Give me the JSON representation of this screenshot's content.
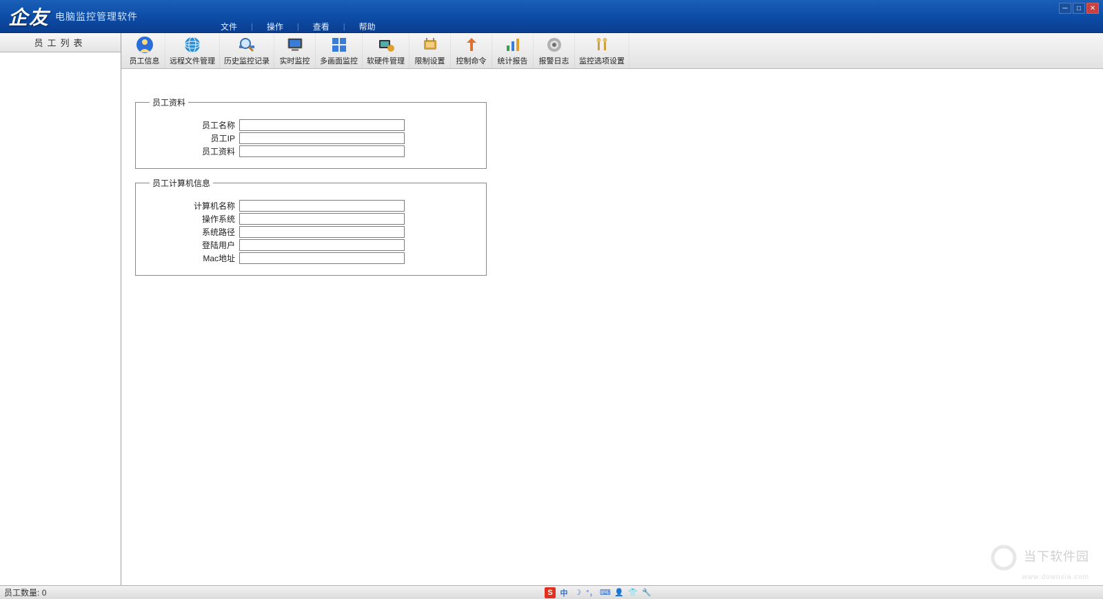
{
  "app": {
    "logo": "企友",
    "subtitle": "电脑监控管理软件"
  },
  "menu": {
    "items": [
      "文件",
      "操作",
      "查看",
      "帮助"
    ]
  },
  "sidebar": {
    "title": "员工列表"
  },
  "toolbar": {
    "items": [
      {
        "label": "员工信息",
        "icon": "person"
      },
      {
        "label": "远程文件管理",
        "icon": "globe"
      },
      {
        "label": "历史监控记录",
        "icon": "magnifier"
      },
      {
        "label": "实时监控",
        "icon": "monitor"
      },
      {
        "label": "多画面监控",
        "icon": "grid"
      },
      {
        "label": "软硬件管理",
        "icon": "hwsw"
      },
      {
        "label": "限制设置",
        "icon": "limit"
      },
      {
        "label": "控制命令",
        "icon": "control"
      },
      {
        "label": "统计报告",
        "icon": "chart"
      },
      {
        "label": "报警日志",
        "icon": "alarm"
      },
      {
        "label": "监控选项设置",
        "icon": "settings"
      }
    ]
  },
  "form": {
    "group1_title": "员工资料",
    "group1": [
      {
        "label": "员工名称",
        "value": ""
      },
      {
        "label": "员工IP",
        "value": ""
      },
      {
        "label": "员工资料",
        "value": ""
      }
    ],
    "group2_title": "员工计算机信息",
    "group2": [
      {
        "label": "计算机名称",
        "value": ""
      },
      {
        "label": "操作系统",
        "value": ""
      },
      {
        "label": "系统路径",
        "value": ""
      },
      {
        "label": "登陆用户",
        "value": ""
      },
      {
        "label": "Mac地址",
        "value": ""
      }
    ]
  },
  "statusbar": {
    "employee_count_label": "员工数量:",
    "employee_count_value": "0"
  },
  "ime": {
    "mode": "中"
  },
  "watermark": {
    "text": "当下软件园",
    "url": "www.downxia.com"
  }
}
